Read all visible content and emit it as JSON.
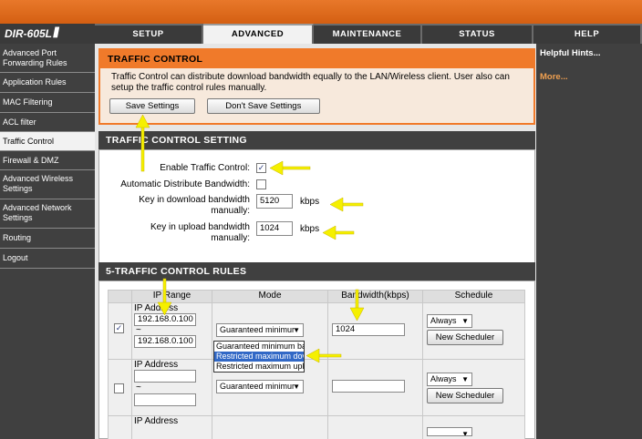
{
  "brand": {
    "model": "DIR-605L"
  },
  "nav": {
    "tabs": [
      {
        "label": "SETUP"
      },
      {
        "label": "ADVANCED"
      },
      {
        "label": "MAINTENANCE"
      },
      {
        "label": "STATUS"
      },
      {
        "label": "HELP"
      }
    ],
    "active": "ADVANCED"
  },
  "sidebar": {
    "items": [
      {
        "label": "Advanced Port Forwarding Rules"
      },
      {
        "label": "Application Rules"
      },
      {
        "label": "MAC Filtering"
      },
      {
        "label": "ACL filter"
      },
      {
        "label": "Traffic Control"
      },
      {
        "label": "Firewall & DMZ"
      },
      {
        "label": "Advanced Wireless Settings"
      },
      {
        "label": "Advanced Network Settings"
      },
      {
        "label": "Routing"
      },
      {
        "label": "Logout"
      }
    ],
    "active": "Traffic Control"
  },
  "intro": {
    "title": "TRAFFIC CONTROL",
    "text": "Traffic Control can distribute download bandwidth equally to the LAN/Wireless client. User also can setup the traffic control rules manually.",
    "save_label": "Save Settings",
    "dont_save_label": "Don't Save Settings"
  },
  "setting": {
    "title": "TRAFFIC CONTROL SETTING",
    "enable_label": "Enable Traffic Control:",
    "enable_checked": true,
    "auto_label": "Automatic Distribute Bandwidth:",
    "auto_checked": false,
    "download_label": "Key in download bandwidth manually:",
    "download_value": "5120",
    "upload_label": "Key in upload bandwidth manually:",
    "upload_value": "1024",
    "unit": "kbps"
  },
  "rules": {
    "title": "5-TRAFFIC CONTROL RULES",
    "headers": {
      "ip": "IP Range",
      "mode": "Mode",
      "bandwidth": "Bandwidth(kbps)",
      "schedule": "Schedule"
    },
    "ip_address_label": "IP Address",
    "tilde": "~",
    "rows": [
      {
        "checked": true,
        "ip_start": "192.168.0.100",
        "ip_end": "192.168.0.100",
        "mode": "Guaranteed minimur",
        "bandwidth": "1024",
        "schedule": "Always",
        "scheduler_label": "New Scheduler"
      },
      {
        "checked": false,
        "ip_start": "",
        "ip_end": "",
        "mode": "Guaranteed minimur",
        "bandwidth": "",
        "schedule": "Always",
        "scheduler_label": "New Scheduler"
      }
    ],
    "mode_options": [
      "Guaranteed minimum bar",
      "Restricted maximum dov",
      "Restricted maximum uplo"
    ],
    "mode_selected_option": "Restricted maximum dov"
  },
  "hints": {
    "title": "Helpful Hints...",
    "more": "More..."
  },
  "colors": {
    "accent": "#f07a2a",
    "annotation_arrow": "#f5f000",
    "nav_bg": "#404040"
  }
}
